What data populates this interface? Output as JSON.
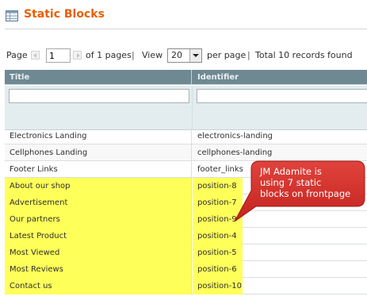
{
  "header": {
    "title": "Static Blocks",
    "icon": "grid-icon",
    "accent_color": "#eb5e00"
  },
  "pager": {
    "page_label": "Page",
    "current_page": "1",
    "of_pages": "of 1 pages",
    "separator": "|",
    "view_label": "View",
    "per_page_value": "20",
    "per_page_label": "per page",
    "total_records": "Total 10 records found"
  },
  "grid": {
    "columns": [
      "Title",
      "Identifier"
    ],
    "header_color": "#6f8992",
    "rows": [
      {
        "title": "Electronics Landing",
        "identifier": "electronics-landing",
        "highlighted": false
      },
      {
        "title": "Cellphones Landing",
        "identifier": "cellphones-landing",
        "highlighted": false
      },
      {
        "title": "Footer Links",
        "identifier": "footer_links",
        "highlighted": false
      },
      {
        "title": "About our shop",
        "identifier": "position-8",
        "highlighted": true
      },
      {
        "title": "Advertisement",
        "identifier": "position-7",
        "highlighted": true
      },
      {
        "title": "Our partners",
        "identifier": "position-9",
        "highlighted": true
      },
      {
        "title": "Latest Product",
        "identifier": "position-4",
        "highlighted": true
      },
      {
        "title": "Most Viewed",
        "identifier": "position-5",
        "highlighted": true
      },
      {
        "title": "Most Reviews",
        "identifier": "position-6",
        "highlighted": true
      },
      {
        "title": "Contact us",
        "identifier": "position-10",
        "highlighted": true
      }
    ],
    "highlight_color": "#ffff5a"
  },
  "callout": {
    "lines": [
      "JM Adamite is",
      "using 7 static",
      "blocks on frontpage"
    ],
    "fill_color": "#d9322e"
  }
}
